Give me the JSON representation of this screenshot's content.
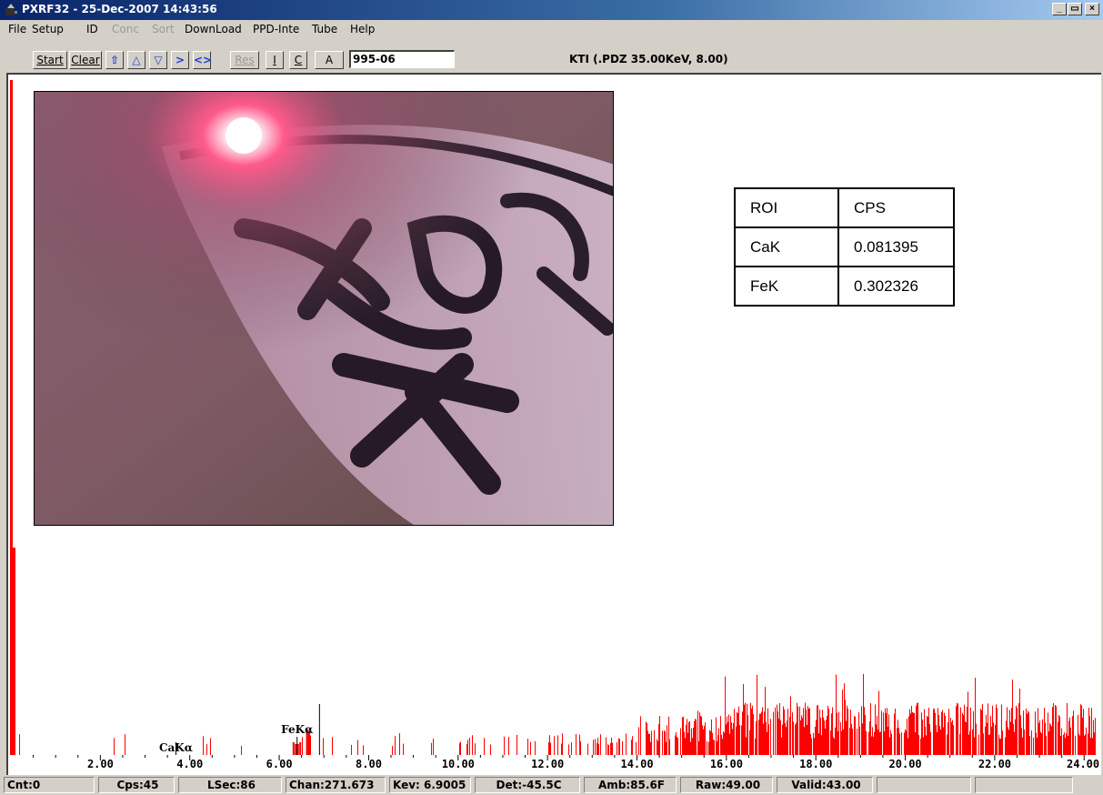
{
  "window": {
    "title": "PXRF32 - 25-Dec-2007 14:43:56",
    "controls": [
      "_",
      "□",
      "X"
    ]
  },
  "menu": {
    "items": [
      {
        "label": "File",
        "enabled": true
      },
      {
        "label": "Setup",
        "enabled": true
      },
      {
        "label": "ID",
        "enabled": true
      },
      {
        "label": "Conc",
        "enabled": false
      },
      {
        "label": "Sort",
        "enabled": false
      },
      {
        "label": "DownLoad",
        "enabled": true
      },
      {
        "label": "PPD-Inte",
        "enabled": true
      },
      {
        "label": "Tube",
        "enabled": true
      },
      {
        "label": "Help",
        "enabled": true
      }
    ]
  },
  "toolbar": {
    "start_label": "Start",
    "clear_label": "Clear",
    "res_label": "Res",
    "i_label": "I",
    "c_label": "C",
    "a_label": "A",
    "id_value": "995-06",
    "mode_text": "KTI  (.PDZ 35.00KeV, 8.00)"
  },
  "roi_table": {
    "header": [
      "ROI",
      "CPS"
    ],
    "rows": [
      [
        "CaK",
        "0.081395"
      ],
      [
        "FeK",
        "0.302326"
      ]
    ]
  },
  "chart_data": {
    "type": "bar",
    "xlabel": "",
    "ylabel": "",
    "xlim": [
      0,
      24.3
    ],
    "ticks": [
      "2.00",
      "4.00",
      "6.00",
      "8.00",
      "10.00",
      "12.00",
      "14.00",
      "16.00",
      "18.00",
      "20.00",
      "22.00",
      "24.00"
    ],
    "tick_values": [
      2,
      4,
      6,
      8,
      10,
      12,
      14,
      16,
      18,
      20,
      22,
      24
    ],
    "peak_labels": [
      {
        "label": "CaKα",
        "x": 3.69
      },
      {
        "label": "FeKα",
        "x": 6.4
      }
    ],
    "cursor_kev": 6.9005,
    "color": "#ff0000"
  },
  "status": {
    "cnt": "Cnt:0",
    "cps": "Cps:45",
    "lsec": "LSec:86",
    "chan": "Chan:271.673",
    "kev": "Kev: 6.9005",
    "det": "Det:-45.5C",
    "amb": "Amb:85.6F",
    "raw": "Raw:49.00",
    "valid": "Valid:43.00"
  }
}
